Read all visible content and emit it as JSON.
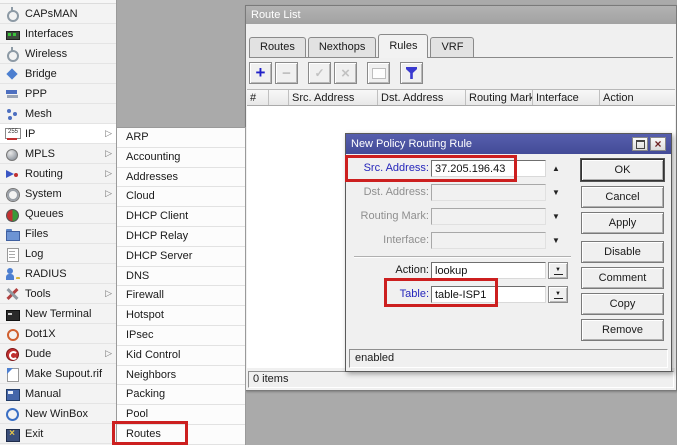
{
  "colors": {
    "annotation_red": "#cc1f1f",
    "dialog_title_bg": "#4a52a4",
    "inactive_title_bg": "#a9a9a9",
    "modified_label_blue": "#2626bb"
  },
  "sidebar": {
    "items": [
      {
        "label": "CAPsMAN",
        "icon": "capsman-icon",
        "has_submenu": false,
        "active": false
      },
      {
        "label": "Interfaces",
        "icon": "interfaces-icon",
        "has_submenu": false,
        "active": false
      },
      {
        "label": "Wireless",
        "icon": "wireless-icon",
        "has_submenu": false,
        "active": false
      },
      {
        "label": "Bridge",
        "icon": "bridge-icon",
        "has_submenu": false,
        "active": false
      },
      {
        "label": "PPP",
        "icon": "ppp-icon",
        "has_submenu": false,
        "active": false
      },
      {
        "label": "Mesh",
        "icon": "mesh-icon",
        "has_submenu": false,
        "active": false
      },
      {
        "label": "IP",
        "icon": "ip-icon",
        "has_submenu": true,
        "active": true
      },
      {
        "label": "MPLS",
        "icon": "mpls-icon",
        "has_submenu": true,
        "active": false
      },
      {
        "label": "Routing",
        "icon": "routing-icon",
        "has_submenu": true,
        "active": false
      },
      {
        "label": "System",
        "icon": "system-icon",
        "has_submenu": true,
        "active": false
      },
      {
        "label": "Queues",
        "icon": "queues-icon",
        "has_submenu": false,
        "active": false
      },
      {
        "label": "Files",
        "icon": "files-icon",
        "has_submenu": false,
        "active": false
      },
      {
        "label": "Log",
        "icon": "log-icon",
        "has_submenu": false,
        "active": false
      },
      {
        "label": "RADIUS",
        "icon": "radius-icon",
        "has_submenu": false,
        "active": false
      },
      {
        "label": "Tools",
        "icon": "tools-icon",
        "has_submenu": true,
        "active": false
      },
      {
        "label": "New Terminal",
        "icon": "terminal-icon",
        "has_submenu": false,
        "active": false
      },
      {
        "label": "Dot1X",
        "icon": "dot1x-icon",
        "has_submenu": false,
        "active": false
      },
      {
        "label": "Dude",
        "icon": "dude-icon",
        "has_submenu": true,
        "active": false
      },
      {
        "label": "Make Supout.rif",
        "icon": "supout-icon",
        "has_submenu": false,
        "active": false
      },
      {
        "label": "Manual",
        "icon": "manual-icon",
        "has_submenu": false,
        "active": false
      },
      {
        "label": "New WinBox",
        "icon": "winbox-icon",
        "has_submenu": false,
        "active": false
      },
      {
        "label": "Exit",
        "icon": "exit-icon",
        "has_submenu": false,
        "active": false
      }
    ]
  },
  "ip_submenu": {
    "items": [
      "ARP",
      "Accounting",
      "Addresses",
      "Cloud",
      "DHCP Client",
      "DHCP Relay",
      "DHCP Server",
      "DNS",
      "Firewall",
      "Hotspot",
      "IPsec",
      "Kid Control",
      "Neighbors",
      "Packing",
      "Pool",
      "Routes"
    ],
    "annotated_item": "Routes"
  },
  "route_list": {
    "title": "Route List",
    "tabs": [
      {
        "label": "Routes",
        "active": false
      },
      {
        "label": "Nexthops",
        "active": false
      },
      {
        "label": "Rules",
        "active": true
      },
      {
        "label": "VRF",
        "active": false
      }
    ],
    "toolbar": [
      {
        "icon": "add-icon",
        "enabled": true
      },
      {
        "icon": "remove-icon",
        "enabled": false
      },
      {
        "icon": "enable-icon",
        "enabled": false
      },
      {
        "icon": "disable-icon",
        "enabled": false
      },
      {
        "icon": "comment-icon",
        "enabled": false
      },
      {
        "icon": "filter-icon",
        "enabled": true
      }
    ],
    "columns": [
      "#",
      "",
      "Src. Address",
      "Dst. Address",
      "Routing Mark",
      "Interface",
      "Action"
    ],
    "status": "0 items"
  },
  "dialog": {
    "title": "New Policy Routing Rule",
    "fields": [
      {
        "label": "Src. Address:",
        "value": "37.205.196.43",
        "filled": true,
        "arrow": "up",
        "annotated": true
      },
      {
        "label": "Dst. Address:",
        "value": "",
        "filled": false,
        "arrow": "down",
        "annotated": false
      },
      {
        "label": "Routing Mark:",
        "value": "",
        "filled": false,
        "arrow": "down",
        "annotated": false
      },
      {
        "label": "Interface:",
        "value": "",
        "filled": false,
        "arrow": "down",
        "annotated": false
      }
    ],
    "combo_fields": [
      {
        "label": "Action:",
        "value": "lookup",
        "annotated": false
      },
      {
        "label": "Table:",
        "value": "table-ISP1",
        "annotated": true
      }
    ],
    "buttons": [
      "OK",
      "Cancel",
      "Apply",
      "Disable",
      "Comment",
      "Copy",
      "Remove"
    ],
    "status": "enabled"
  }
}
